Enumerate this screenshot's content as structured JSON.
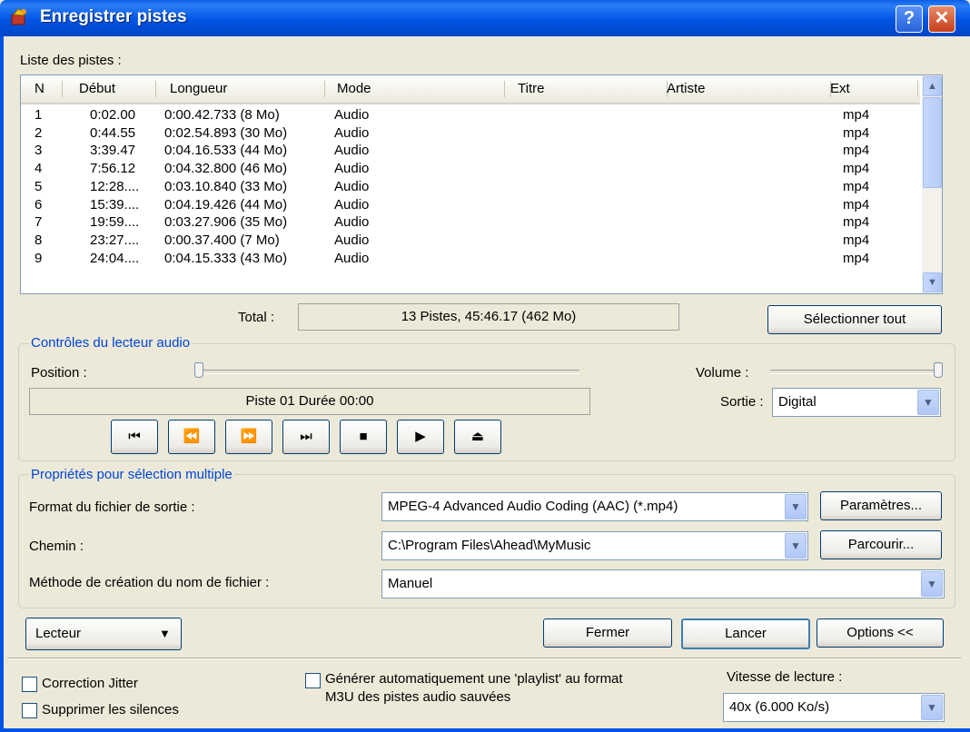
{
  "window": {
    "title": "Enregistrer pistes",
    "help_glyph": "?",
    "close_glyph": "✕"
  },
  "tracklist": {
    "label": "Liste des pistes :",
    "columns": [
      "N",
      "Début",
      "Longueur",
      "Mode",
      "Titre",
      "Artiste",
      "Ext"
    ],
    "rows": [
      [
        "1",
        "0:02.00",
        "0:00.42.733 (8 Mo)",
        "Audio",
        "",
        "",
        "mp4"
      ],
      [
        "2",
        "0:44.55",
        "0:02.54.893 (30 Mo)",
        "Audio",
        "",
        "",
        "mp4"
      ],
      [
        "3",
        "3:39.47",
        "0:04.16.533 (44 Mo)",
        "Audio",
        "",
        "",
        "mp4"
      ],
      [
        "4",
        "7:56.12",
        "0:04.32.800 (46 Mo)",
        "Audio",
        "",
        "",
        "mp4"
      ],
      [
        "5",
        "12:28....",
        "0:03.10.840 (33 Mo)",
        "Audio",
        "",
        "",
        "mp4"
      ],
      [
        "6",
        "15:39....",
        "0:04.19.426 (44 Mo)",
        "Audio",
        "",
        "",
        "mp4"
      ],
      [
        "7",
        "19:59....",
        "0:03.27.906 (35 Mo)",
        "Audio",
        "",
        "",
        "mp4"
      ],
      [
        "8",
        "23:27....",
        "0:00.37.400 (7 Mo)",
        "Audio",
        "",
        "",
        "mp4"
      ],
      [
        "9",
        "24:04....",
        "0:04.15.333 (43 Mo)",
        "Audio",
        "",
        "",
        "mp4"
      ]
    ],
    "total_label": "Total :",
    "total_value": "13 Pistes,   45:46.17 (462 Mo)",
    "select_all": "Sélectionner tout"
  },
  "player": {
    "group_title": "Contrôles du lecteur audio",
    "position_label": "Position :",
    "volume_label": "Volume :",
    "status": "Piste 01 Durée 00:00",
    "output_label": "Sortie :",
    "output_value": "Digital",
    "buttons": [
      "⏮",
      "⏪",
      "⏩",
      "⏭",
      "■",
      "▶",
      "⏏"
    ],
    "position_level": 0,
    "volume_level": 1
  },
  "multi": {
    "group_title": "Propriétés pour sélection multiple",
    "format_label": "Format du fichier de sortie :",
    "format_value": "MPEG-4 Advanced Audio Coding (AAC) (*.mp4)",
    "params_button": "Paramètres...",
    "path_label": "Chemin :",
    "path_value": "C:\\Program Files\\Ahead\\MyMusic",
    "browse_button": "Parcourir...",
    "naming_label": "Méthode de création du nom de fichier :",
    "naming_value": "Manuel"
  },
  "actions": {
    "player_button": "Lecteur",
    "close_button": "Fermer",
    "start_button": "Lancer",
    "options_button": "Options <<"
  },
  "options": {
    "jitter": "Correction Jitter",
    "silence": "Supprimer les silences",
    "playlist_line1": "Générer automatiquement une 'playlist' au format",
    "playlist_line2": "M3U des pistes audio sauvées",
    "speed_label": "Vitesse de lecture :",
    "speed_value": "40x (6.000 Ko/s)"
  },
  "icons": {
    "combo_arrow": "chevron-down-icon",
    "scroll_up": "arrow-up-icon",
    "scroll_down": "arrow-down-icon"
  }
}
